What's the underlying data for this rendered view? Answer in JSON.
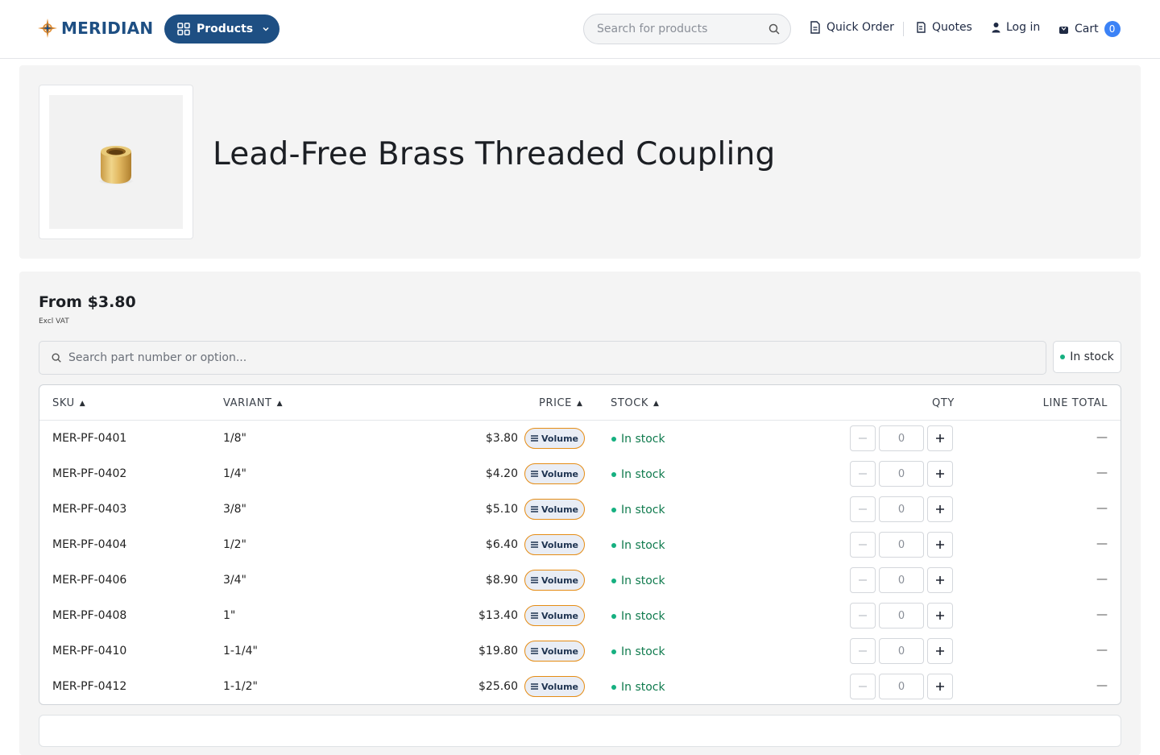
{
  "brand": {
    "name": "MERIDIAN",
    "logo_icon": "compass-star-icon",
    "color": "#1e4f83"
  },
  "header": {
    "products_label": "Products",
    "search_placeholder": "Search for products",
    "quick_order": "Quick Order",
    "quotes": "Quotes",
    "login": "Log in",
    "cart": "Cart",
    "cart_count": "0"
  },
  "product": {
    "title": "Lead-Free Brass Threaded Coupling",
    "image_alt": "brass-coupling"
  },
  "pricing": {
    "from_label": "From",
    "from_price": "$3.80",
    "tax_note": "Excl VAT"
  },
  "filters": {
    "search_placeholder": "Search part number or option...",
    "stock_filter": "In stock"
  },
  "table": {
    "headers": {
      "sku": "SKU",
      "variant": "VARIANT",
      "price": "PRICE",
      "stock": "STOCK",
      "qty": "QTY",
      "line_total": "LINE TOTAL"
    },
    "volume_label": "Volume",
    "rows": [
      {
        "sku": "MER-PF-0401",
        "variant": "1/8\"",
        "price": "$3.80",
        "stock": "In stock",
        "qty": "0",
        "line_total": "—"
      },
      {
        "sku": "MER-PF-0402",
        "variant": "1/4\"",
        "price": "$4.20",
        "stock": "In stock",
        "qty": "0",
        "line_total": "—"
      },
      {
        "sku": "MER-PF-0403",
        "variant": "3/8\"",
        "price": "$5.10",
        "stock": "In stock",
        "qty": "0",
        "line_total": "—"
      },
      {
        "sku": "MER-PF-0404",
        "variant": "1/2\"",
        "price": "$6.40",
        "stock": "In stock",
        "qty": "0",
        "line_total": "—"
      },
      {
        "sku": "MER-PF-0406",
        "variant": "3/4\"",
        "price": "$8.90",
        "stock": "In stock",
        "qty": "0",
        "line_total": "—"
      },
      {
        "sku": "MER-PF-0408",
        "variant": "1\"",
        "price": "$13.40",
        "stock": "In stock",
        "qty": "0",
        "line_total": "—"
      },
      {
        "sku": "MER-PF-0410",
        "variant": "1-1/4\"",
        "price": "$19.80",
        "stock": "In stock",
        "qty": "0",
        "line_total": "—"
      },
      {
        "sku": "MER-PF-0412",
        "variant": "1-1/2\"",
        "price": "$25.60",
        "stock": "In stock",
        "qty": "0",
        "line_total": "—"
      }
    ]
  },
  "colors": {
    "accent": "#1e4f83",
    "badge": "#3b82f6",
    "stock_green": "#16b080",
    "volume_border": "#e58c14"
  }
}
